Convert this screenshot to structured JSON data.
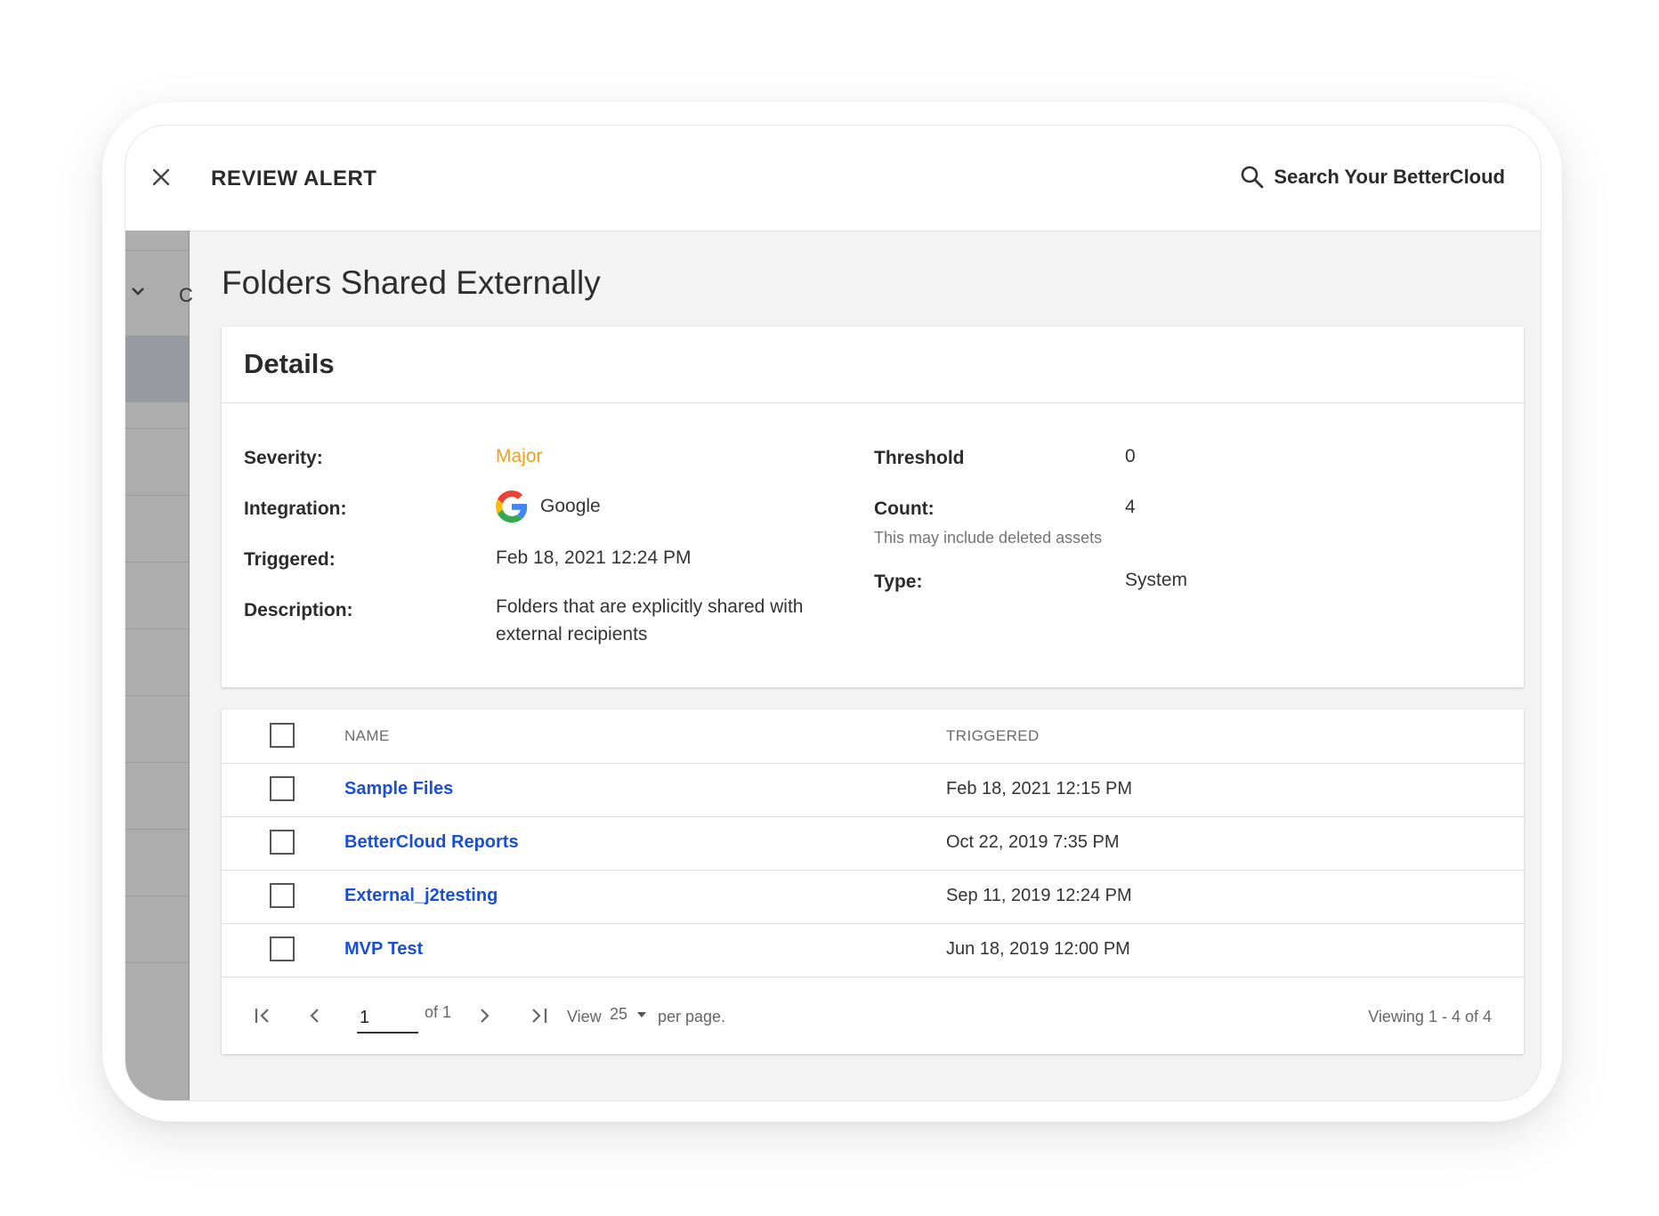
{
  "topbar": {
    "title": "REVIEW ALERT",
    "search_label": "Search Your BetterCloud"
  },
  "sidebar": {
    "partial_letter": "C"
  },
  "page": {
    "title": "Folders Shared Externally"
  },
  "details": {
    "heading": "Details",
    "severity_label": "Severity:",
    "severity_value": "Major",
    "integration_label": "Integration:",
    "integration_value": "Google",
    "triggered_label": "Triggered:",
    "triggered_value": "Feb 18, 2021 12:24 PM",
    "description_label": "Description:",
    "description_value": "Folders that are explicitly shared with external recipients",
    "threshold_label": "Threshold",
    "threshold_value": "0",
    "count_label": "Count:",
    "count_value": "4",
    "count_note": "This may include deleted assets",
    "type_label": "Type:",
    "type_value": "System"
  },
  "table": {
    "columns": [
      "NAME",
      "TRIGGERED"
    ],
    "rows": [
      {
        "name": "Sample Files",
        "triggered": "Feb 18, 2021 12:15 PM"
      },
      {
        "name": "BetterCloud Reports",
        "triggered": "Oct 22, 2019 7:35 PM"
      },
      {
        "name": "External_j2testing",
        "triggered": "Sep 11, 2019 12:24 PM"
      },
      {
        "name": "MVP Test",
        "triggered": "Jun 18, 2019 12:00 PM"
      }
    ]
  },
  "pagination": {
    "current_page": "1",
    "of_text": "of 1",
    "view_label": "View",
    "per_page_value": "25",
    "per_page_suffix": "per page.",
    "viewing_text": "Viewing 1 - 4 of 4"
  },
  "colors": {
    "severity_major": "#f0a020",
    "link": "#1a4fd6"
  }
}
